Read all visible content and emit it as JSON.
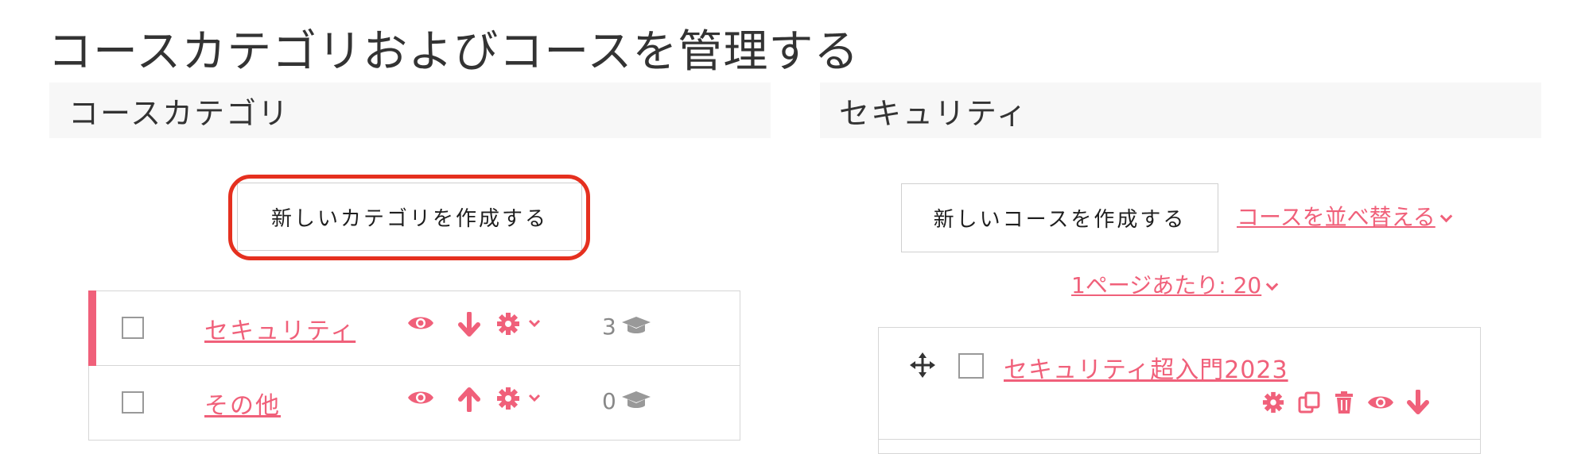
{
  "page": {
    "title": "コースカテゴリおよびコースを管理する"
  },
  "left_panel": {
    "header": "コースカテゴリ",
    "create_button": "新しいカテゴリを作成する",
    "categories": [
      {
        "name": "セキュリティ",
        "count": "3",
        "active": true,
        "move_icon": "arrow-down-icon"
      },
      {
        "name": "その他",
        "count": "0",
        "active": false,
        "move_icon": "arrow-up-icon"
      }
    ]
  },
  "right_panel": {
    "header": "セキュリティ",
    "create_button": "新しいコースを作成する",
    "sort_link": "コースを並べ替える",
    "per_page_link": "1ページあたり: 20",
    "courses": [
      {
        "name": "セキュリティ超入門2023"
      }
    ]
  },
  "colors": {
    "accent": "#f0607a",
    "highlight_ring": "#e5301f",
    "header_bg": "#f7f7f7"
  },
  "icons": [
    "eye-icon",
    "arrow-down-icon",
    "arrow-up-icon",
    "gear-icon",
    "chevron-down-icon",
    "graduation-cap-icon",
    "move-icon",
    "copy-icon",
    "trash-icon"
  ]
}
